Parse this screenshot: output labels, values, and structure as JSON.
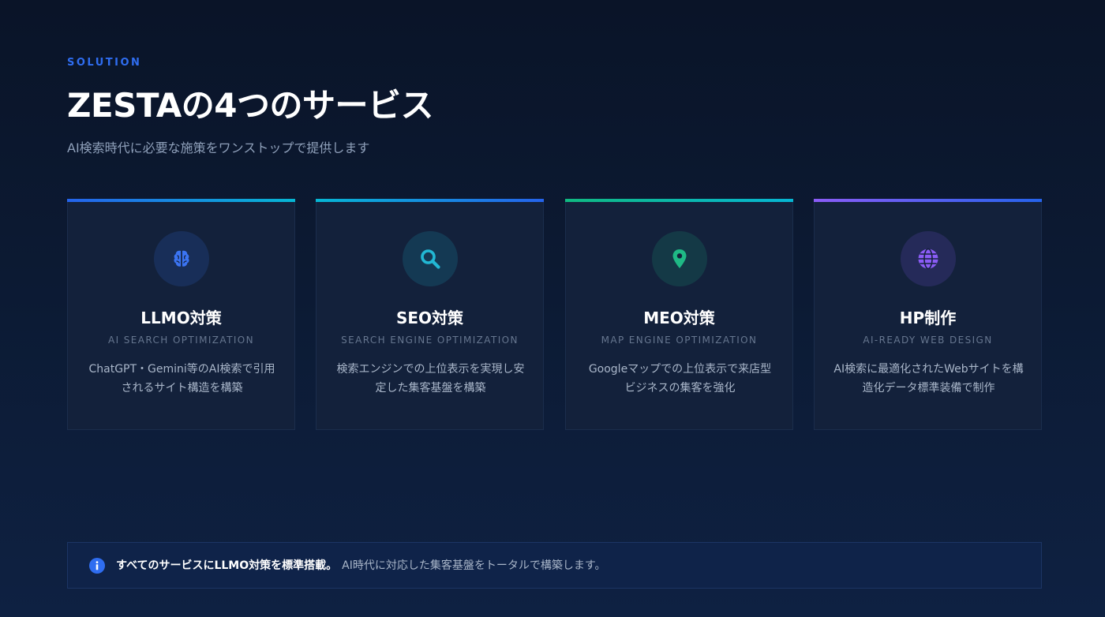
{
  "header": {
    "eyebrow": "SOLUTION",
    "title": "ZESTAの4つのサービス",
    "subtitle": "AI検索時代に必要な施策をワンストップで提供します"
  },
  "services": [
    {
      "name": "LLMO対策",
      "sub": "AI SEARCH OPTIMIZATION",
      "desc": "ChatGPT・Gemini等のAI検索で引用されるサイト構造を構築",
      "icon": "brain-icon",
      "accent": "#3b74f2",
      "bar_from": "#2563eb",
      "bar_to": "#06b6d4"
    },
    {
      "name": "SEO対策",
      "sub": "SEARCH ENGINE OPTIMIZATION",
      "desc": "検索エンジンでの上位表示を実現し安定した集客基盤を構築",
      "icon": "search-icon",
      "accent": "#22b8d4",
      "bar_from": "#06b6d4",
      "bar_to": "#2563eb"
    },
    {
      "name": "MEO対策",
      "sub": "MAP ENGINE OPTIMIZATION",
      "desc": "Googleマップでの上位表示で来店型ビジネスの集客を強化",
      "icon": "map-pin-icon",
      "accent": "#1fb985",
      "bar_from": "#10b981",
      "bar_to": "#06b6d4"
    },
    {
      "name": "HP制作",
      "sub": "AI-READY WEB DESIGN",
      "desc": "AI検索に最適化されたWebサイトを構造化データ標準装備で制作",
      "icon": "globe-icon",
      "accent": "#8b5cf6",
      "bar_from": "#8b5cf6",
      "bar_to": "#2563eb"
    }
  ],
  "note": {
    "icon": "info-icon",
    "strong": "すべてのサービスにLLMO対策を標準搭載。",
    "rest": "AI時代に対応した集客基盤をトータルで構築します。",
    "accent": "#2f6df0"
  }
}
